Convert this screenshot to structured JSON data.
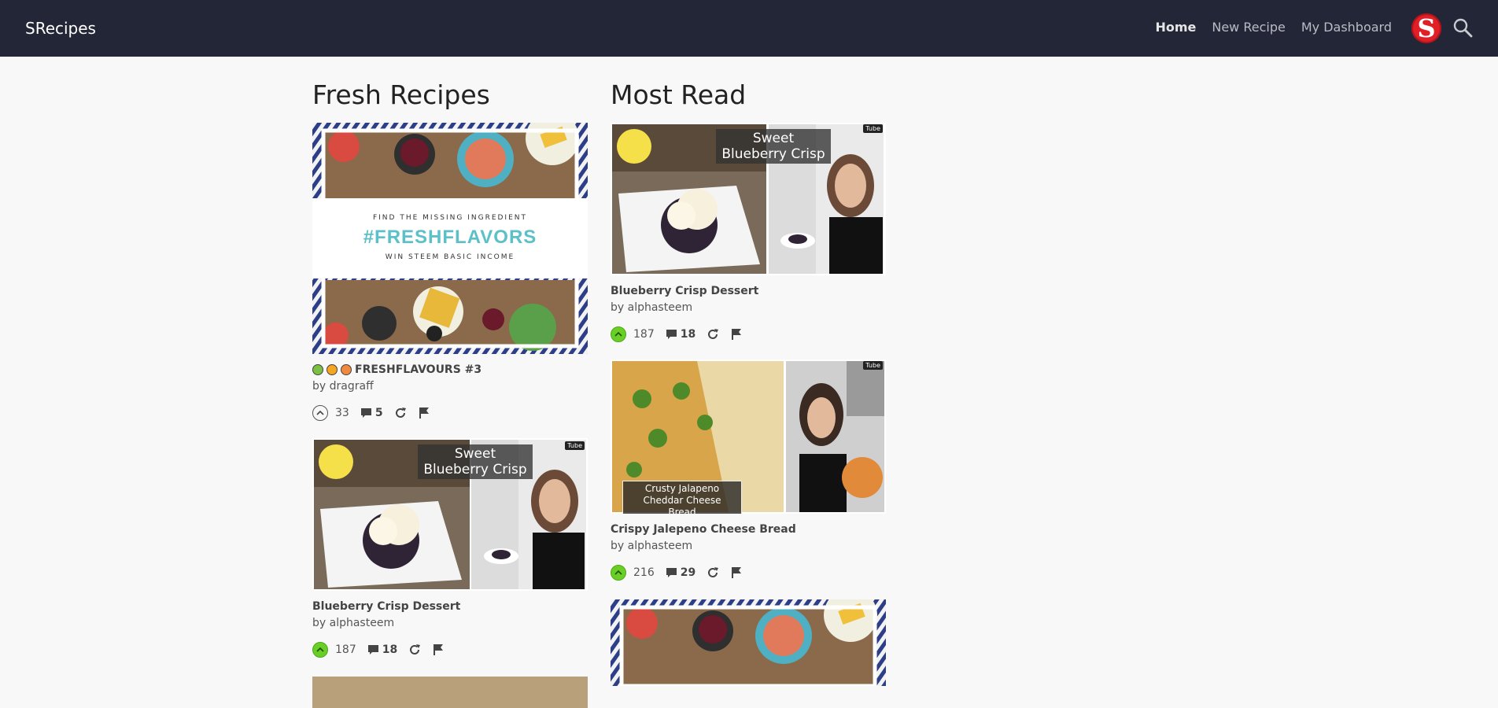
{
  "header": {
    "brand": "SRecipes",
    "nav": [
      {
        "label": "Home",
        "active": true
      },
      {
        "label": "New Recipe",
        "active": false
      },
      {
        "label": "My Dashboard",
        "active": false
      }
    ],
    "avatar_letter": "S",
    "colors": {
      "bar": "#232637",
      "avatar": "#e01f26",
      "voted": "#69cf27"
    }
  },
  "fresh": {
    "title": "Fresh Recipes",
    "cards": [
      {
        "title": "FRESHFLAVOURS #3",
        "author": "by dragraff",
        "votes": "33",
        "comments": "5",
        "voted": false,
        "banner_line1": "FIND THE MISSING INGREDIENT",
        "banner_hash": "#FRESHFLAVORS",
        "banner_line2": "WIN STEEM BASIC INCOME"
      },
      {
        "title": "Blueberry Crisp Dessert",
        "author": "by alphasteem",
        "votes": "187",
        "comments": "18",
        "voted": true,
        "overlay": "Sweet Blueberry Crisp",
        "badge": "Tube"
      }
    ]
  },
  "most_read": {
    "title": "Most Read",
    "cards": [
      {
        "title": "Blueberry Crisp Dessert",
        "author": "by alphasteem",
        "votes": "187",
        "comments": "18",
        "voted": true,
        "overlay": "Sweet Blueberry Crisp",
        "badge": "Tube"
      },
      {
        "title": "Crispy Jalepeno Cheese Bread",
        "author": "by alphasteem",
        "votes": "216",
        "comments": "29",
        "voted": true,
        "overlay": "Crusty Jalapeno Cheddar Cheese Bread",
        "badge": "Tube"
      }
    ]
  }
}
